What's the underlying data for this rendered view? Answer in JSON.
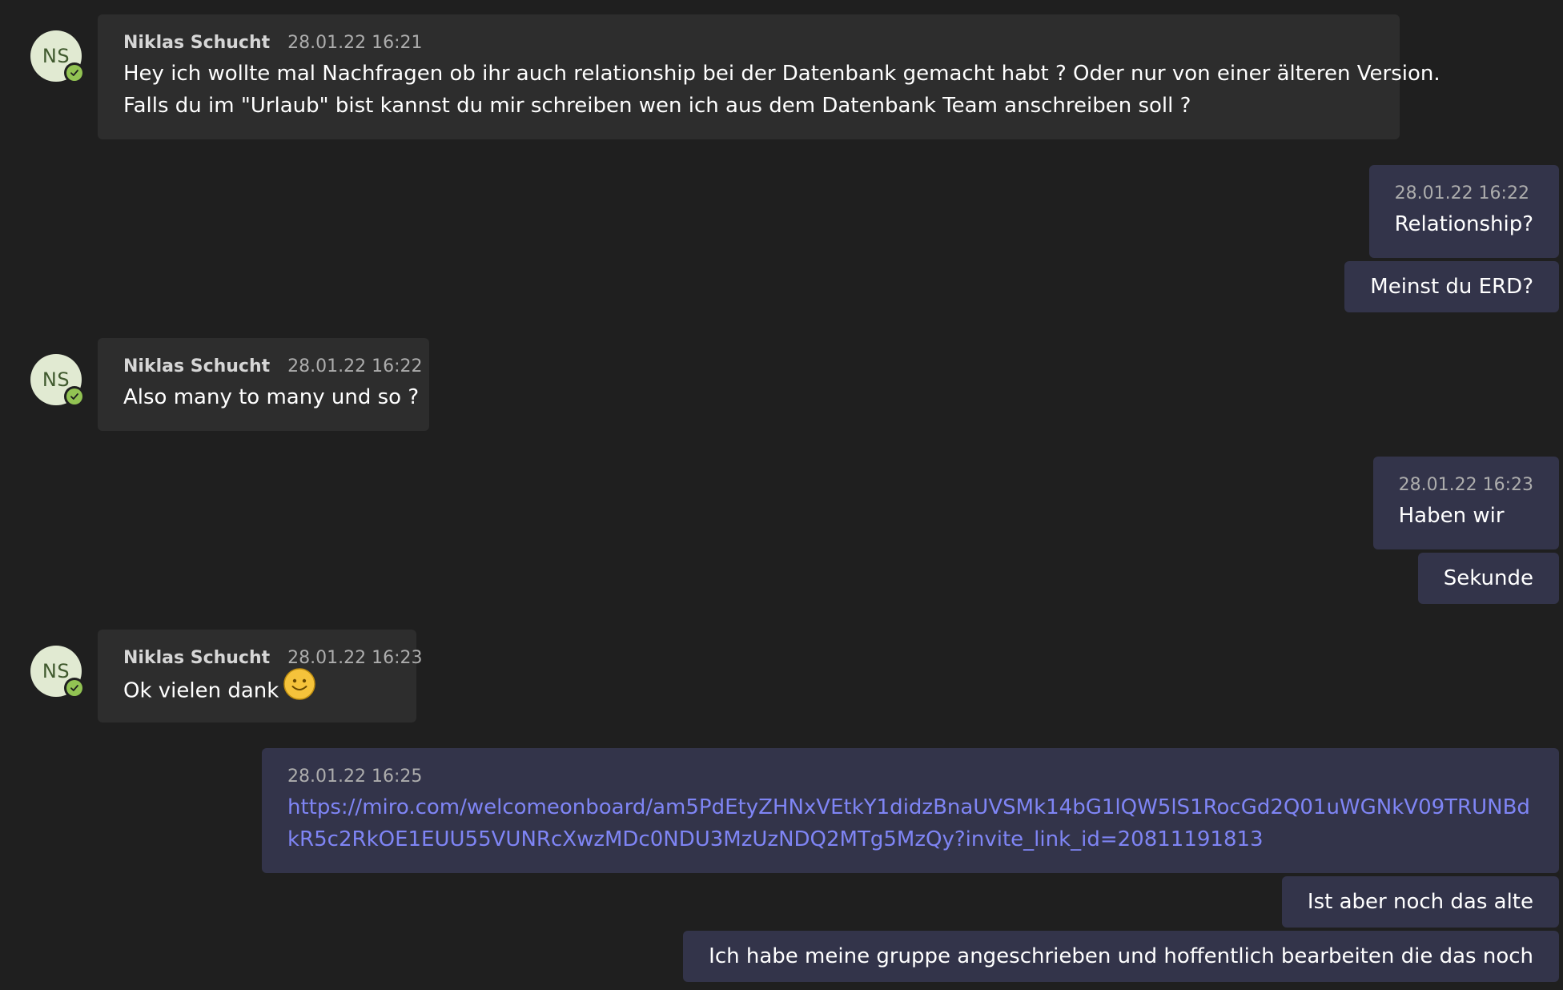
{
  "messages": [
    {
      "direction": "incoming",
      "sender": "Niklas Schucht",
      "initials": "NS",
      "time": "28.01.22 16:21",
      "lines": [
        "Hey ich wollte mal Nachfragen ob ihr auch relationship bei der Datenbank gemacht habt ? Oder nur von einer älteren Version.",
        "Falls du im \"Urlaub\" bist kannst du mir schreiben wen ich aus dem Datenbank Team anschreiben soll ?"
      ]
    },
    {
      "direction": "outgoing",
      "time": "28.01.22 16:22",
      "text": "Relationship?"
    },
    {
      "direction": "outgoing",
      "text": "Meinst du ERD?"
    },
    {
      "direction": "incoming",
      "sender": "Niklas Schucht",
      "initials": "NS",
      "time": "28.01.22 16:22",
      "text": "Also many to many und so ?"
    },
    {
      "direction": "outgoing",
      "time": "28.01.22 16:23",
      "text": "Haben wir"
    },
    {
      "direction": "outgoing",
      "text": "Sekunde"
    },
    {
      "direction": "incoming",
      "sender": "Niklas Schucht",
      "initials": "NS",
      "time": "28.01.22 16:23",
      "text": "Ok vielen dank",
      "emoji": "smiley-emoji"
    },
    {
      "direction": "outgoing",
      "time": "28.01.22 16:25",
      "link": "https://miro.com/welcomeonboard/am5PdEtyZHNxVEtkY1didzBnaUVSMk14bG1lQW5lS1RocGd2Q01uWGNkV09TRUNBdkR5c2RkOE1EUU55VUNRcXwzMDc0NDU3MzUzNDQ2MTg5MzQy?invite_link_id=20811191813"
    },
    {
      "direction": "outgoing",
      "text": "Ist aber noch das alte"
    },
    {
      "direction": "outgoing",
      "text": "Ich habe meine gruppe angeschrieben und hoffentlich bearbeiten die das noch"
    }
  ],
  "icons": {
    "presence": "available-check-icon",
    "emoji": "smiley-emoji"
  },
  "colors": {
    "background": "#1f1f1f",
    "incoming_bubble": "#2d2d2d",
    "outgoing_bubble": "#33344a",
    "link": "#7f85f5",
    "presence_available": "#92c353",
    "avatar_bg": "#e1ead2",
    "avatar_fg": "#405a2e"
  }
}
